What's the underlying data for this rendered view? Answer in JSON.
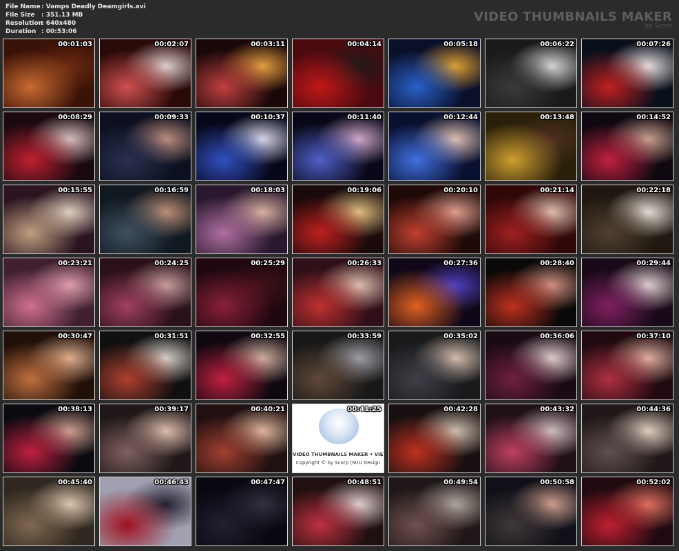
{
  "file_info": {
    "file_name_label": "File Name",
    "file_name": ": Vamps Deadly Deamgirls.avi",
    "file_size_label": "File Size",
    "file_size": ": 351.13 MB",
    "resolution_label": "Resolution",
    "resolution": ": 640x480",
    "duration_label": "Duration",
    "duration": ": 00:53:06"
  },
  "brand": {
    "title": "VIDEO THUMBNAILS MAKER",
    "subtitle": "by Scorp"
  },
  "logo_tile": {
    "text": "VIDEO THUMBNAILS MAKER • VIEW",
    "copyright": "Copyright © by Scorp (SUU Design"
  },
  "thumbnails": [
    {
      "time": "00:01:03",
      "bg": "#3a1208",
      "a": "#c86a30",
      "b": "#6b2a10"
    },
    {
      "time": "00:02:07",
      "bg": "#2a0a08",
      "a": "#d05050",
      "b": "#e0d0d0"
    },
    {
      "time": "00:03:11",
      "bg": "#1a0808",
      "a": "#c04040",
      "b": "#e6a040"
    },
    {
      "time": "00:04:14",
      "bg": "#4a0a10",
      "a": "#c01818",
      "b": "#221a1a"
    },
    {
      "time": "00:05:18",
      "bg": "#0a0f2a",
      "a": "#2a60c8",
      "b": "#e0a030"
    },
    {
      "time": "00:06:22",
      "bg": "#1a1a1a",
      "a": "#3a3a3a",
      "b": "#d8d8d8"
    },
    {
      "time": "00:07:26",
      "bg": "#0a0f1c",
      "a": "#c02020",
      "b": "#e8e0e0"
    },
    {
      "time": "00:08:29",
      "bg": "#1a0a10",
      "a": "#c02030",
      "b": "#d8c0c0"
    },
    {
      "time": "00:09:33",
      "bg": "#0c1020",
      "a": "#2a3050",
      "b": "#c09080"
    },
    {
      "time": "00:10:37",
      "bg": "#08081c",
      "a": "#3050c0",
      "b": "#d8d8e8"
    },
    {
      "time": "00:11:40",
      "bg": "#080818",
      "a": "#5060c8",
      "b": "#d0a8c8"
    },
    {
      "time": "00:12:44",
      "bg": "#0a1030",
      "a": "#4070e0",
      "b": "#e0c0b0"
    },
    {
      "time": "00:13:48",
      "bg": "#2a200a",
      "a": "#d0a030",
      "b": "#503020"
    },
    {
      "time": "00:14:52",
      "bg": "#100810",
      "a": "#c02040",
      "b": "#c8a090"
    },
    {
      "time": "00:15:55",
      "bg": "#2a1420",
      "a": "#c0a080",
      "b": "#e0d0c0"
    },
    {
      "time": "00:16:59",
      "bg": "#101820",
      "a": "#405060",
      "b": "#c09078"
    },
    {
      "time": "00:18:03",
      "bg": "#2a1830",
      "a": "#b070a0",
      "b": "#d8b0a0"
    },
    {
      "time": "00:19:06",
      "bg": "#1a0a0a",
      "a": "#c02020",
      "b": "#e0c080"
    },
    {
      "time": "00:20:10",
      "bg": "#200a08",
      "a": "#c04030",
      "b": "#e0a090"
    },
    {
      "time": "00:21:14",
      "bg": "#300808",
      "a": "#a02020",
      "b": "#e0c0b0"
    },
    {
      "time": "00:22:18",
      "bg": "#201810",
      "a": "#504030",
      "b": "#e8e0d8"
    },
    {
      "time": "00:23:21",
      "bg": "#402030",
      "a": "#d07090",
      "b": "#e0a0b0"
    },
    {
      "time": "00:24:25",
      "bg": "#2a1018",
      "a": "#a04060",
      "b": "#c8a0a0"
    },
    {
      "time": "00:25:29",
      "bg": "#200810",
      "a": "#8a2038",
      "b": "#401018"
    },
    {
      "time": "00:26:33",
      "bg": "#301018",
      "a": "#c03030",
      "b": "#e0c0b0"
    },
    {
      "time": "00:27:36",
      "bg": "#100818",
      "a": "#e06020",
      "b": "#5040c0"
    },
    {
      "time": "00:28:40",
      "bg": "#0a0808",
      "a": "#c03020",
      "b": "#d09080"
    },
    {
      "time": "00:29:44",
      "bg": "#180a18",
      "a": "#802060",
      "b": "#e0d0d0"
    },
    {
      "time": "00:30:47",
      "bg": "#201008",
      "a": "#c07040",
      "b": "#e0b090"
    },
    {
      "time": "00:31:51",
      "bg": "#101010",
      "a": "#b04030",
      "b": "#d8d0c8"
    },
    {
      "time": "00:32:55",
      "bg": "#100810",
      "a": "#c02040",
      "b": "#d0b0a0"
    },
    {
      "time": "00:33:59",
      "bg": "#181818",
      "a": "#604838",
      "b": "#a0a0a8"
    },
    {
      "time": "00:35:02",
      "bg": "#181a1c",
      "a": "#404048",
      "b": "#d8c0b0"
    },
    {
      "time": "00:36:06",
      "bg": "#1a0a14",
      "a": "#702040",
      "b": "#e0d0d0"
    },
    {
      "time": "00:37:10",
      "bg": "#200a10",
      "a": "#b03040",
      "b": "#e0b0a0"
    },
    {
      "time": "00:38:13",
      "bg": "#0a0a10",
      "a": "#c02040",
      "b": "#d0a090"
    },
    {
      "time": "00:39:17",
      "bg": "#201818",
      "a": "#806060",
      "b": "#e0c0b0"
    },
    {
      "time": "00:40:21",
      "bg": "#201010",
      "a": "#a04030",
      "b": "#e0b8a0"
    },
    {
      "time": "00:41:25",
      "bg": "#ffffff",
      "a": "#6090d0",
      "b": "#f0c040"
    },
    {
      "time": "00:42:28",
      "bg": "#181010",
      "a": "#c03020",
      "b": "#d0c0b0"
    },
    {
      "time": "00:43:32",
      "bg": "#201018",
      "a": "#c04060",
      "b": "#d0c0c0"
    },
    {
      "time": "00:44:36",
      "bg": "#201818",
      "a": "#605050",
      "b": "#e0d0c0"
    },
    {
      "time": "00:45:40",
      "bg": "#302820",
      "a": "#806850",
      "b": "#e0c8b0"
    },
    {
      "time": "00:46:43",
      "bg": "#a0a0b0",
      "a": "#a01020",
      "b": "#202030"
    },
    {
      "time": "00:47:47",
      "bg": "#080810",
      "a": "#202030",
      "b": "#303040"
    },
    {
      "time": "00:48:51",
      "bg": "#201010",
      "a": "#c03040",
      "b": "#e0d0d0"
    },
    {
      "time": "00:49:54",
      "bg": "#201818",
      "a": "#705050",
      "b": "#b0a8a0"
    },
    {
      "time": "00:50:58",
      "bg": "#101018",
      "a": "#403838",
      "b": "#d0a090"
    },
    {
      "time": "00:52:02",
      "bg": "#200a10",
      "a": "#c02030",
      "b": "#e07060"
    }
  ]
}
